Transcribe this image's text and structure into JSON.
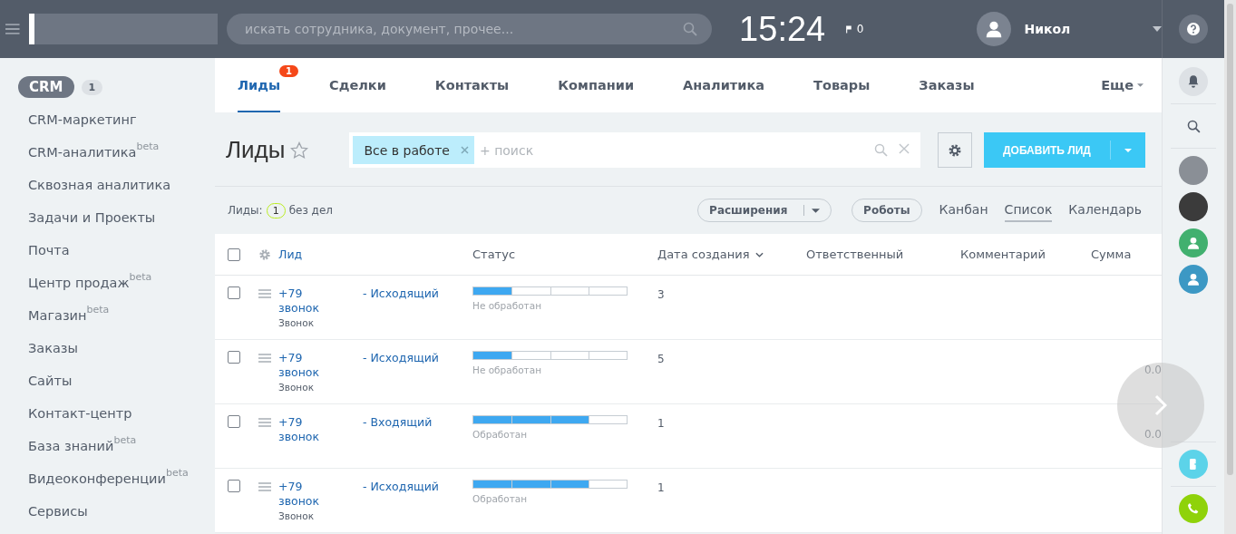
{
  "header": {
    "search": {
      "placeholder": "искать сотрудника, документ, прочее..."
    },
    "clock": "15:24",
    "flag_count": "0",
    "user": {
      "name": "Никол"
    }
  },
  "sidebar": {
    "title": "CRM",
    "counter": "1",
    "items": [
      {
        "label": "CRM-маркетинг"
      },
      {
        "label": "CRM-аналитика",
        "badge": "beta"
      },
      {
        "label": "Сквозная аналитика"
      },
      {
        "label": "Задачи и Проекты"
      },
      {
        "label": "Почта"
      },
      {
        "label": "Центр продаж",
        "badge": "beta"
      },
      {
        "label": "Магазин",
        "badge": "beta"
      },
      {
        "label": "Заказы"
      },
      {
        "label": "Сайты"
      },
      {
        "label": "Контакт-центр"
      },
      {
        "label": "База знаний",
        "badge": "beta"
      },
      {
        "label": "Видеоконференции",
        "badge": "beta"
      },
      {
        "label": "Сервисы"
      }
    ]
  },
  "tabs": [
    {
      "label": "Лиды",
      "selected": true,
      "counter": "1"
    },
    {
      "label": "Сделки",
      "selected": false
    },
    {
      "label": "Контакты",
      "selected": false
    },
    {
      "label": "Компании",
      "selected": false
    },
    {
      "label": "Аналитика",
      "selected": false
    },
    {
      "label": "Товары",
      "selected": false
    },
    {
      "label": "Заказы",
      "selected": false
    }
  ],
  "more_tab": "Еще",
  "page_title": "Лиды",
  "filter": {
    "tag": "Все в работе",
    "placeholder": "+ поиск"
  },
  "add_button": "ДОБАВИТЬ ЛИД",
  "summary": {
    "label": "Лиды:",
    "count": "1",
    "suffix": "без дел"
  },
  "toolbar": {
    "extensions": "Расширения",
    "robots": "Роботы",
    "views": [
      {
        "label": "Канбан",
        "selected": false
      },
      {
        "label": "Список",
        "selected": true
      },
      {
        "label": "Календарь",
        "selected": false
      }
    ]
  },
  "table": {
    "all_checked": false,
    "columns": [
      "Лид",
      "Статус",
      "Дата создания",
      "Ответственный",
      "Комментарий",
      "Сумма"
    ],
    "rows": [
      {
        "checked": false,
        "phone": "+79",
        "direction": "- Исходящий",
        "title_2": "звонок",
        "source": "Звонок",
        "level": 0.25,
        "status": "Не обработан",
        "date": "3"
      },
      {
        "checked": false,
        "phone": "+79",
        "direction": "- Исходящий",
        "title_2": "звонок",
        "source": "Звонок",
        "level": 0.25,
        "status": "Не обработан",
        "date": "5",
        "sum": "0.0"
      },
      {
        "checked": false,
        "phone": "+79",
        "direction": "- Входящий",
        "title_2": "звонок",
        "level": 0.75,
        "status": "Обработан",
        "date": "1",
        "sum": "0.0"
      },
      {
        "checked": false,
        "phone": "+79",
        "direction": "- Исходящий",
        "title_2": "звонок",
        "source": "Звонок",
        "level": 0.75,
        "status": "Обработан",
        "date": "1"
      }
    ]
  }
}
